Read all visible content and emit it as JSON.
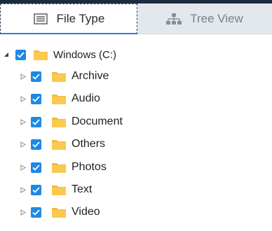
{
  "tabs": [
    {
      "label": "File Type",
      "icon": "list-icon",
      "active": true
    },
    {
      "label": "Tree View",
      "icon": "tree-hierarchy-icon",
      "active": false
    }
  ],
  "tree": {
    "root": {
      "label": "Windows (C:)",
      "checked": true,
      "expanded": true
    },
    "children": [
      {
        "label": "Archive",
        "checked": true,
        "expanded": false
      },
      {
        "label": "Audio",
        "checked": true,
        "expanded": false
      },
      {
        "label": "Document",
        "checked": true,
        "expanded": false
      },
      {
        "label": "Others",
        "checked": true,
        "expanded": false
      },
      {
        "label": "Photos",
        "checked": true,
        "expanded": false
      },
      {
        "label": "Text",
        "checked": true,
        "expanded": false
      },
      {
        "label": "Video",
        "checked": true,
        "expanded": false
      }
    ]
  },
  "colors": {
    "accent": "#1e88e5",
    "folder": "#f6b93b",
    "header_bar": "#1c2b3f",
    "inactive_tab_bg": "#e3e8ef"
  }
}
